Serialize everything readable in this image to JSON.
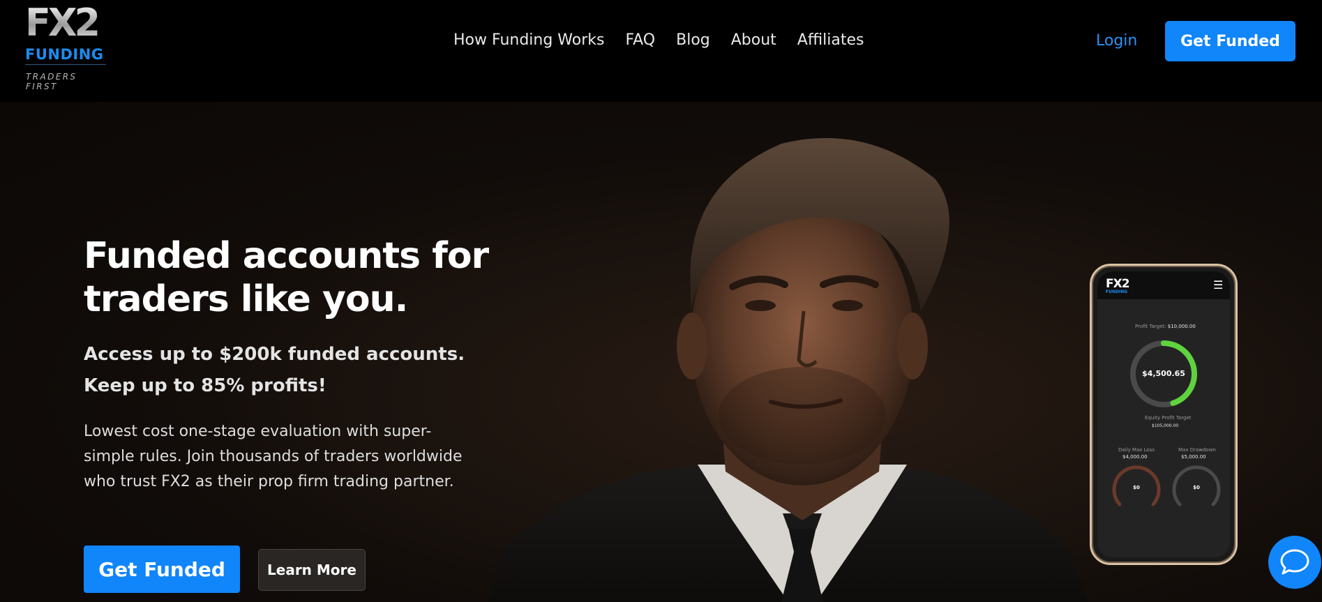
{
  "header": {
    "logo": {
      "wordmark": "FX2",
      "subword": "FUNDING",
      "tagline": "TRADERS FIRST"
    },
    "nav": [
      {
        "label": "How Funding Works"
      },
      {
        "label": "FAQ"
      },
      {
        "label": "Blog"
      },
      {
        "label": "About"
      },
      {
        "label": "Affiliates"
      }
    ],
    "login_label": "Login",
    "cta_label": "Get Funded"
  },
  "hero": {
    "headline": "Funded accounts for traders like you.",
    "subheadline_1": "Access up to $200k funded accounts.",
    "subheadline_2": "Keep up to 85% profits!",
    "description": "Lowest cost one-stage evaluation with super-simple rules. Join thousands of traders worldwide who trust FX2 as their prop firm trading partner.",
    "primary_button": "Get Funded",
    "secondary_button": "Learn More"
  },
  "phone": {
    "logo": "FX2",
    "logo_sub": "FUNDING",
    "menu_icon": "hamburger-icon",
    "profit_target_label": "Profit Target:",
    "profit_target_value": "$10,000.00",
    "profit_progress": 0.45,
    "equity_value": "$4,500.65",
    "equity_label": "Equity Profit Target",
    "equity_target_value": "$105,000.00",
    "daily_max_loss_label": "Daily Max Loss",
    "daily_max_loss_value": "$4,000.00",
    "daily_gauge_value": "$0",
    "max_drawdown_label": "Max Drawdown",
    "max_drawdown_value": "$5,000.00",
    "drawdown_gauge_value": "$0"
  },
  "colors": {
    "accent": "#1185fa",
    "login": "#2b91f3",
    "gauge_green": "#5fd33d",
    "gauge_brown": "#6b3a2a"
  },
  "chat_icon": "chat-bubble-icon"
}
